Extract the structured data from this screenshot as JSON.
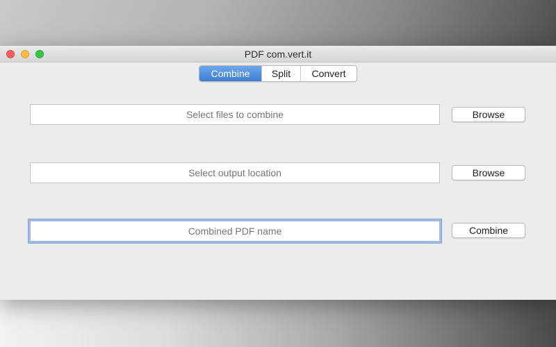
{
  "window": {
    "title": "PDF com.vert.it"
  },
  "tabs": [
    {
      "label": "Combine",
      "active": true
    },
    {
      "label": "Split",
      "active": false
    },
    {
      "label": "Convert",
      "active": false
    }
  ],
  "form": {
    "files": {
      "placeholder": "Select files to combine",
      "value": "",
      "button_label": "Browse"
    },
    "output": {
      "placeholder": "Select output location",
      "value": "",
      "button_label": "Browse"
    },
    "name": {
      "placeholder": "Combined PDF name",
      "value": "",
      "button_label": "Combine"
    }
  },
  "colors": {
    "accent": "#3c7fd6",
    "focus_ring": "#9fbce0",
    "close": "#fc605c",
    "minimize": "#fdbc40",
    "maximize": "#34c84a"
  }
}
